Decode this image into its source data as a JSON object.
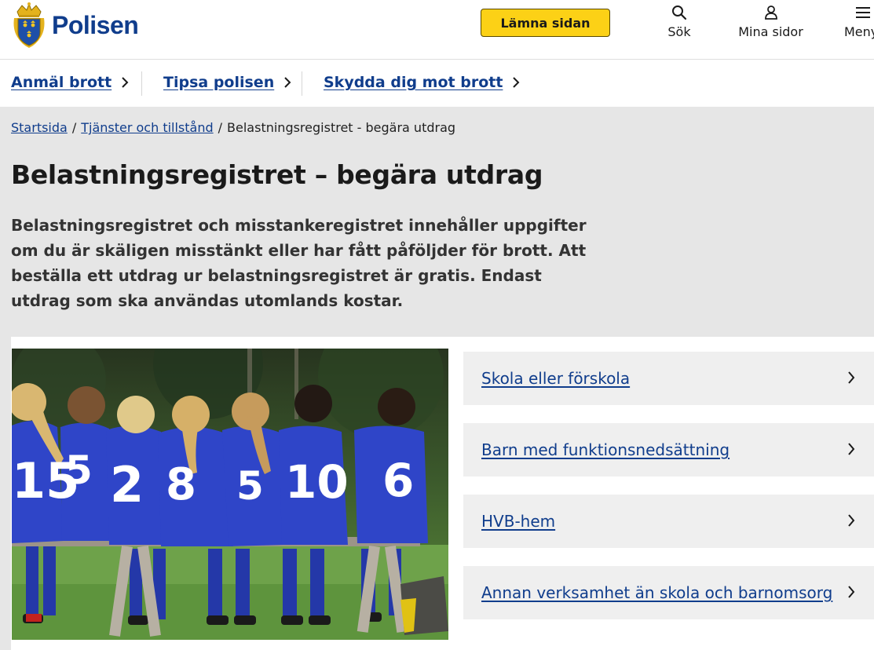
{
  "header": {
    "logo_text": "Polisen",
    "leave_button": "Lämna sidan",
    "search_label": "Sök",
    "my_pages_label": "Mina sidor",
    "menu_label": "Meny"
  },
  "service_nav": [
    {
      "label": "Anmäl brott",
      "icon": "chevron-right-icon"
    },
    {
      "label": "Tipsa polisen",
      "icon": "chevron-right-icon"
    },
    {
      "label": "Skydda dig mot brott",
      "icon": "chevron-right-icon"
    }
  ],
  "breadcrumb": {
    "items": [
      "Startsida",
      "Tjänster och tillstånd"
    ],
    "separator": "/",
    "current": "Belastningsregistret - begära utdrag"
  },
  "page": {
    "title": "Belastningsregistret – begära utdrag",
    "lead": "Belastningsregistret och misstankeregistret innehåller uppgifter om du är skäligen misstänkt eller har fått påföljder för brott. Att beställa ett utdrag ur belastningsregistret är gratis. Endast utdrag som ska användas utomlands kostar."
  },
  "cards": [
    {
      "label": "Skola eller förskola"
    },
    {
      "label": "Barn med funktionsnedsättning"
    },
    {
      "label": "HVB-hem"
    },
    {
      "label": "Annan verksamhet än skola och barnomsorg"
    }
  ],
  "photo": {
    "jersey_numbers": [
      "15",
      "5",
      "2",
      "8",
      "5",
      "10",
      "6"
    ]
  },
  "colors": {
    "brand_blue": "#103d8c",
    "leave_button_yellow": "#fcd116",
    "page_background": "#e6e6e6",
    "card_background": "#efefef",
    "jersey_blue": "#2f45c8"
  }
}
